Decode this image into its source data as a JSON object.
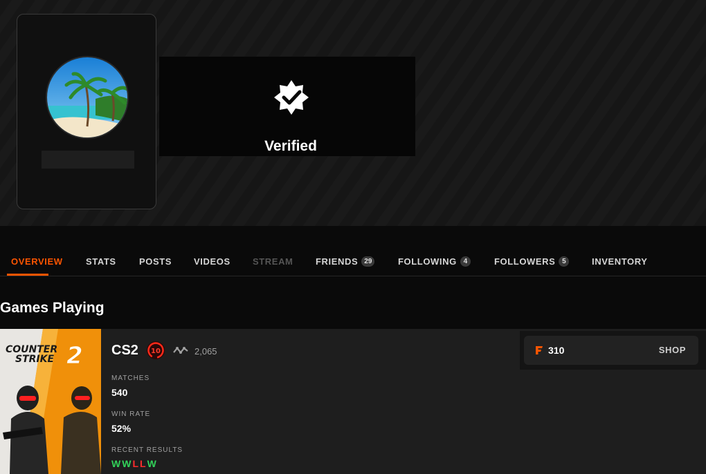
{
  "profile": {
    "verified_label": "Verified"
  },
  "tabs": [
    {
      "label": "OVERVIEW"
    },
    {
      "label": "STATS"
    },
    {
      "label": "POSTS"
    },
    {
      "label": "VIDEOS"
    },
    {
      "label": "STREAM"
    },
    {
      "label": "FRIENDS",
      "count": "29"
    },
    {
      "label": "FOLLOWING",
      "count": "4"
    },
    {
      "label": "FOLLOWERS",
      "count": "5"
    },
    {
      "label": "INVENTORY"
    }
  ],
  "section_title": "Games Playing",
  "game": {
    "art_title_1": "COUNTER",
    "art_title_2": "STRIKE",
    "art_number": "2",
    "name": "CS2",
    "level": "10",
    "elo": "2,065",
    "matches_label": "MATCHES",
    "matches_value": "540",
    "winrate_label": "WIN RATE",
    "winrate_value": "52%",
    "recent_label": "RECENT RESULTS",
    "recent_results": [
      "W",
      "W",
      "L",
      "L",
      "W"
    ]
  },
  "shop": {
    "points": "310",
    "label": "SHOP"
  },
  "colors": {
    "accent": "#ff5500",
    "win": "#32d35a",
    "loss": "#ff2d2d"
  }
}
